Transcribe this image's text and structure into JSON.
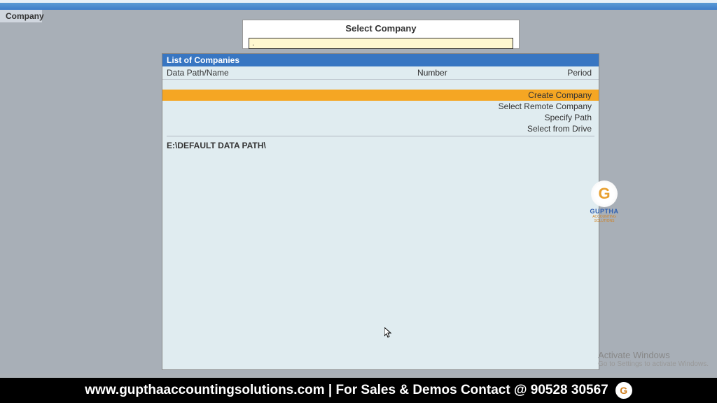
{
  "sidebar": {
    "company_label": "Company"
  },
  "select_panel": {
    "title": "Select Company",
    "input_value": "."
  },
  "list": {
    "header": "List of Companies",
    "columns": {
      "name": "Data Path/Name",
      "number": "Number",
      "period": "Period"
    },
    "actions": {
      "create": "Create Company",
      "remote": "Select Remote Company",
      "specify": "Specify Path",
      "drive": "Select from Drive"
    },
    "data_path": "E:\\DEFAULT DATA PATH\\"
  },
  "logo": {
    "letter": "G",
    "brand": "GUPTHA",
    "tagline": "ACCOUNTING SOLUTIONS"
  },
  "watermark": {
    "line1": "Activate Windows",
    "line2": "Go to Settings to activate Windows."
  },
  "footer": {
    "text": "www.gupthaaccountingsolutions.com | For Sales & Demos Contact @ 90528 30567",
    "logo_letter": "G"
  }
}
